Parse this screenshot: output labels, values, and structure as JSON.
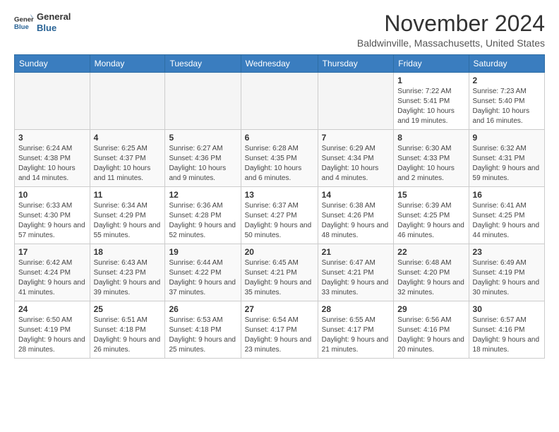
{
  "logo": {
    "line1": "General",
    "line2": "Blue"
  },
  "title": "November 2024",
  "subtitle": "Baldwinville, Massachusetts, United States",
  "days_of_week": [
    "Sunday",
    "Monday",
    "Tuesday",
    "Wednesday",
    "Thursday",
    "Friday",
    "Saturday"
  ],
  "weeks": [
    [
      {
        "day": "",
        "info": ""
      },
      {
        "day": "",
        "info": ""
      },
      {
        "day": "",
        "info": ""
      },
      {
        "day": "",
        "info": ""
      },
      {
        "day": "",
        "info": ""
      },
      {
        "day": "1",
        "info": "Sunrise: 7:22 AM\nSunset: 5:41 PM\nDaylight: 10 hours and 19 minutes."
      },
      {
        "day": "2",
        "info": "Sunrise: 7:23 AM\nSunset: 5:40 PM\nDaylight: 10 hours and 16 minutes."
      }
    ],
    [
      {
        "day": "3",
        "info": "Sunrise: 6:24 AM\nSunset: 4:38 PM\nDaylight: 10 hours and 14 minutes."
      },
      {
        "day": "4",
        "info": "Sunrise: 6:25 AM\nSunset: 4:37 PM\nDaylight: 10 hours and 11 minutes."
      },
      {
        "day": "5",
        "info": "Sunrise: 6:27 AM\nSunset: 4:36 PM\nDaylight: 10 hours and 9 minutes."
      },
      {
        "day": "6",
        "info": "Sunrise: 6:28 AM\nSunset: 4:35 PM\nDaylight: 10 hours and 6 minutes."
      },
      {
        "day": "7",
        "info": "Sunrise: 6:29 AM\nSunset: 4:34 PM\nDaylight: 10 hours and 4 minutes."
      },
      {
        "day": "8",
        "info": "Sunrise: 6:30 AM\nSunset: 4:33 PM\nDaylight: 10 hours and 2 minutes."
      },
      {
        "day": "9",
        "info": "Sunrise: 6:32 AM\nSunset: 4:31 PM\nDaylight: 9 hours and 59 minutes."
      }
    ],
    [
      {
        "day": "10",
        "info": "Sunrise: 6:33 AM\nSunset: 4:30 PM\nDaylight: 9 hours and 57 minutes."
      },
      {
        "day": "11",
        "info": "Sunrise: 6:34 AM\nSunset: 4:29 PM\nDaylight: 9 hours and 55 minutes."
      },
      {
        "day": "12",
        "info": "Sunrise: 6:36 AM\nSunset: 4:28 PM\nDaylight: 9 hours and 52 minutes."
      },
      {
        "day": "13",
        "info": "Sunrise: 6:37 AM\nSunset: 4:27 PM\nDaylight: 9 hours and 50 minutes."
      },
      {
        "day": "14",
        "info": "Sunrise: 6:38 AM\nSunset: 4:26 PM\nDaylight: 9 hours and 48 minutes."
      },
      {
        "day": "15",
        "info": "Sunrise: 6:39 AM\nSunset: 4:25 PM\nDaylight: 9 hours and 46 minutes."
      },
      {
        "day": "16",
        "info": "Sunrise: 6:41 AM\nSunset: 4:25 PM\nDaylight: 9 hours and 44 minutes."
      }
    ],
    [
      {
        "day": "17",
        "info": "Sunrise: 6:42 AM\nSunset: 4:24 PM\nDaylight: 9 hours and 41 minutes."
      },
      {
        "day": "18",
        "info": "Sunrise: 6:43 AM\nSunset: 4:23 PM\nDaylight: 9 hours and 39 minutes."
      },
      {
        "day": "19",
        "info": "Sunrise: 6:44 AM\nSunset: 4:22 PM\nDaylight: 9 hours and 37 minutes."
      },
      {
        "day": "20",
        "info": "Sunrise: 6:45 AM\nSunset: 4:21 PM\nDaylight: 9 hours and 35 minutes."
      },
      {
        "day": "21",
        "info": "Sunrise: 6:47 AM\nSunset: 4:21 PM\nDaylight: 9 hours and 33 minutes."
      },
      {
        "day": "22",
        "info": "Sunrise: 6:48 AM\nSunset: 4:20 PM\nDaylight: 9 hours and 32 minutes."
      },
      {
        "day": "23",
        "info": "Sunrise: 6:49 AM\nSunset: 4:19 PM\nDaylight: 9 hours and 30 minutes."
      }
    ],
    [
      {
        "day": "24",
        "info": "Sunrise: 6:50 AM\nSunset: 4:19 PM\nDaylight: 9 hours and 28 minutes."
      },
      {
        "day": "25",
        "info": "Sunrise: 6:51 AM\nSunset: 4:18 PM\nDaylight: 9 hours and 26 minutes."
      },
      {
        "day": "26",
        "info": "Sunrise: 6:53 AM\nSunset: 4:18 PM\nDaylight: 9 hours and 25 minutes."
      },
      {
        "day": "27",
        "info": "Sunrise: 6:54 AM\nSunset: 4:17 PM\nDaylight: 9 hours and 23 minutes."
      },
      {
        "day": "28",
        "info": "Sunrise: 6:55 AM\nSunset: 4:17 PM\nDaylight: 9 hours and 21 minutes."
      },
      {
        "day": "29",
        "info": "Sunrise: 6:56 AM\nSunset: 4:16 PM\nDaylight: 9 hours and 20 minutes."
      },
      {
        "day": "30",
        "info": "Sunrise: 6:57 AM\nSunset: 4:16 PM\nDaylight: 9 hours and 18 minutes."
      }
    ]
  ]
}
